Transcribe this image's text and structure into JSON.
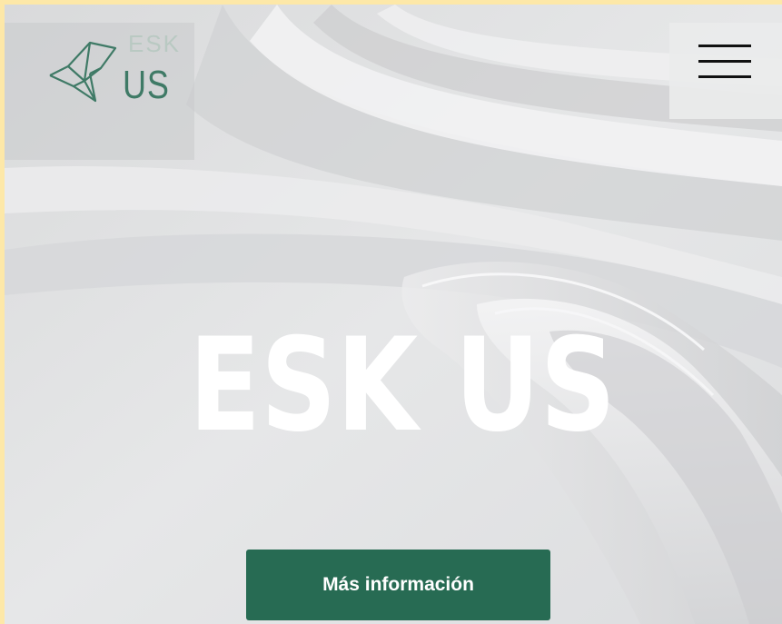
{
  "header": {
    "logo": {
      "esk_text": "ESK",
      "us_text": "US",
      "brand_color": "#3f7a66",
      "icon": "origami-bird-icon"
    },
    "menu_icon": "hamburger-menu-icon"
  },
  "hero": {
    "title": "ESK US",
    "cta_label": "Más información",
    "cta_color": "#276b53"
  }
}
